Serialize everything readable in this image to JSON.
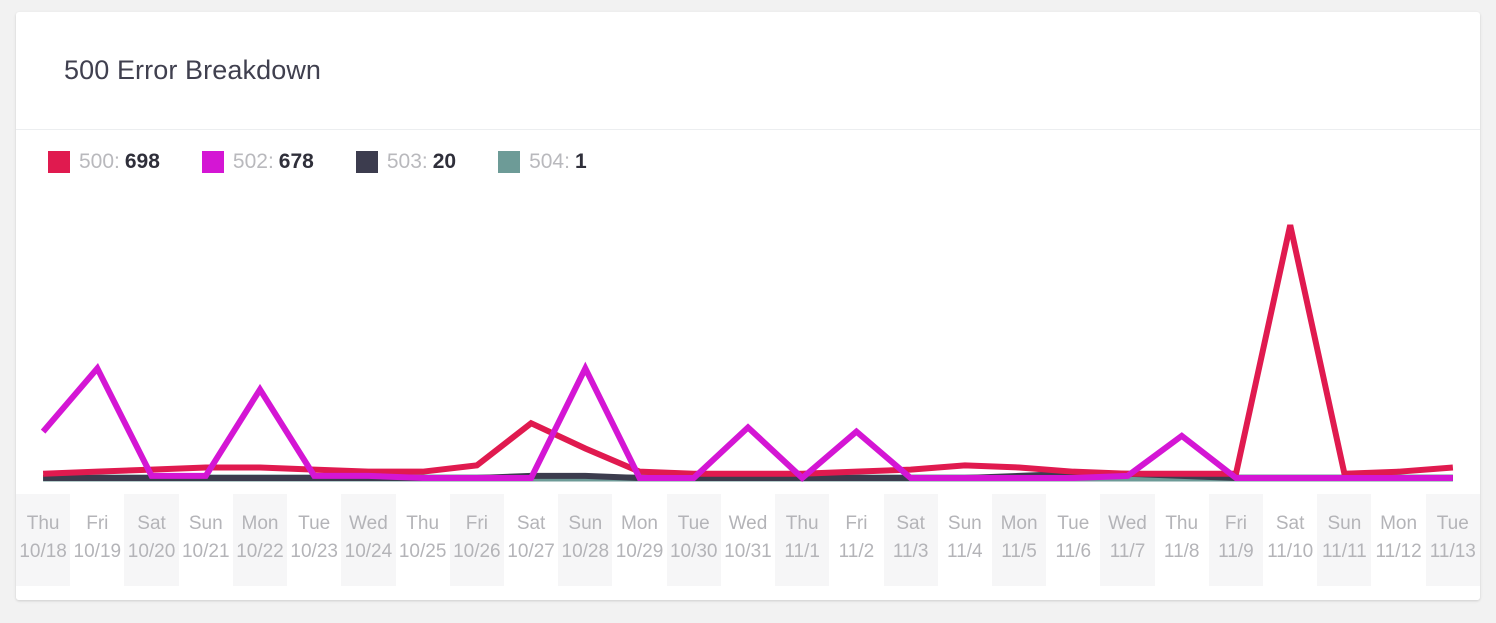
{
  "card": {
    "title": "500 Error Breakdown"
  },
  "legend": [
    {
      "key": "500:",
      "value": "698",
      "color": "#e01a4f"
    },
    {
      "key": "502:",
      "value": "678",
      "color": "#d416d4"
    },
    {
      "key": "503:",
      "value": "20",
      "color": "#3c3c4e"
    },
    {
      "key": "504:",
      "value": "1",
      "color": "#6d9b97"
    }
  ],
  "chart_data": {
    "type": "line",
    "title": "500 Error Breakdown",
    "xlabel": "",
    "ylabel": "",
    "grid": false,
    "legend_position": "top-left",
    "ylim": [
      0,
      130
    ],
    "categories": [
      "Thu 10/18",
      "Fri 10/19",
      "Sat 10/20",
      "Sun 10/21",
      "Mon 10/22",
      "Tue 10/23",
      "Wed 10/24",
      "Thu 10/25",
      "Fri 10/26",
      "Sat 10/27",
      "Sun 10/28",
      "Mon 10/29",
      "Tue 10/30",
      "Wed 10/31",
      "Thu 11/1",
      "Fri 11/2",
      "Sat 11/3",
      "Sun 11/4",
      "Mon 11/5",
      "Tue 11/6",
      "Wed 11/7",
      "Thu 11/8",
      "Fri 11/9",
      "Sat 11/10",
      "Sun 11/11",
      "Mon 11/12",
      "Tue 11/13"
    ],
    "days": [
      "Thu",
      "Fri",
      "Sat",
      "Sun",
      "Mon",
      "Tue",
      "Wed",
      "Thu",
      "Fri",
      "Sat",
      "Sun",
      "Mon",
      "Tue",
      "Wed",
      "Thu",
      "Fri",
      "Sat",
      "Sun",
      "Mon",
      "Tue",
      "Wed",
      "Thu",
      "Fri",
      "Sat",
      "Sun",
      "Mon",
      "Tue"
    ],
    "dates": [
      "10/18",
      "10/19",
      "10/20",
      "10/21",
      "10/22",
      "10/23",
      "10/24",
      "10/25",
      "10/26",
      "10/27",
      "10/28",
      "10/29",
      "10/30",
      "10/31",
      "11/1",
      "11/2",
      "11/3",
      "11/4",
      "11/5",
      "11/6",
      "11/7",
      "11/8",
      "11/9",
      "11/10",
      "11/11",
      "11/12",
      "11/13"
    ],
    "series": [
      {
        "name": "500",
        "total": 698,
        "color": "#e01a4f",
        "values": [
          2,
          3,
          4,
          5,
          5,
          4,
          3,
          3,
          6,
          26,
          14,
          3,
          2,
          2,
          2,
          3,
          4,
          6,
          5,
          3,
          2,
          2,
          2,
          120,
          2,
          3,
          5
        ]
      },
      {
        "name": "502",
        "total": 678,
        "color": "#d416d4",
        "values": [
          22,
          52,
          1,
          1,
          42,
          1,
          1,
          0,
          0,
          0,
          52,
          0,
          0,
          24,
          0,
          22,
          0,
          0,
          0,
          0,
          1,
          20,
          0,
          0,
          0,
          0,
          0
        ]
      },
      {
        "name": "503",
        "total": 20,
        "color": "#3c3c4e",
        "values": [
          0,
          0,
          0,
          0,
          0,
          0,
          0,
          0,
          0,
          1,
          1,
          0,
          0,
          0,
          0,
          0,
          0,
          0,
          1,
          2,
          2,
          1,
          0,
          0,
          0,
          0,
          0
        ]
      },
      {
        "name": "504",
        "total": 1,
        "color": "#6d9b97",
        "values": [
          0,
          0,
          0,
          0,
          0,
          0,
          0,
          0,
          0,
          0,
          0,
          0,
          0,
          0,
          0,
          0,
          0,
          0,
          0,
          0,
          0,
          0,
          0,
          0,
          0,
          0,
          0
        ]
      }
    ]
  }
}
